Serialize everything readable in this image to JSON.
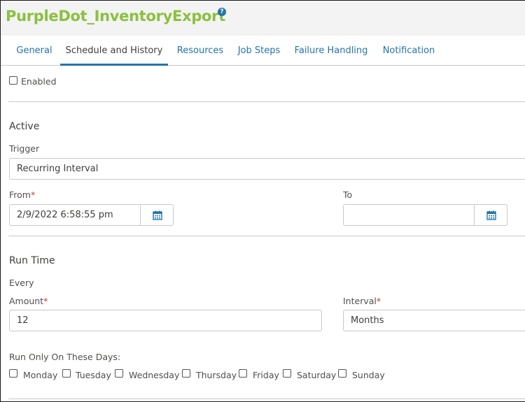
{
  "header": {
    "title": "PurpleDot_InventoryExport",
    "help_icon": "?"
  },
  "tabs": [
    {
      "label": "General"
    },
    {
      "label": "Schedule and History"
    },
    {
      "label": "Resources"
    },
    {
      "label": "Job Steps"
    },
    {
      "label": "Failure Handling"
    },
    {
      "label": "Notification"
    }
  ],
  "active_tab": "Schedule and History",
  "enabled": {
    "label": "Enabled",
    "checked": false
  },
  "active_section": {
    "heading": "Active",
    "trigger_label": "Trigger",
    "trigger_value": "Recurring Interval",
    "from_label": "From",
    "from_value": "2/9/2022 6:58:55 pm",
    "to_label": "To",
    "to_value": "",
    "required_mark": "*"
  },
  "run_time": {
    "heading": "Run Time",
    "every_label": "Every",
    "amount_label": "Amount",
    "amount_value": "12",
    "interval_label": "Interval",
    "interval_value": "Months",
    "days_label": "Run Only On These Days:",
    "days": [
      "Monday",
      "Tuesday",
      "Wednesday",
      "Thursday",
      "Friday",
      "Saturday",
      "Sunday"
    ]
  },
  "colors": {
    "title": "#8bc03f",
    "link": "#2574a9",
    "required": "#c23934"
  }
}
